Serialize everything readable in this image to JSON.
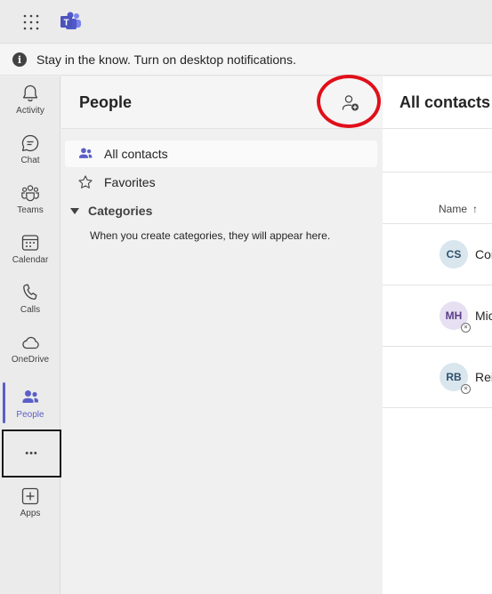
{
  "banner": {
    "text": "Stay in the know. Turn on desktop notifications."
  },
  "rail": {
    "items": [
      {
        "label": "Activity",
        "icon": "bell-icon"
      },
      {
        "label": "Chat",
        "icon": "chat-icon"
      },
      {
        "label": "Teams",
        "icon": "teams-icon"
      },
      {
        "label": "Calendar",
        "icon": "calendar-icon"
      },
      {
        "label": "Calls",
        "icon": "phone-icon"
      },
      {
        "label": "OneDrive",
        "icon": "cloud-icon"
      },
      {
        "label": "People",
        "icon": "people-icon"
      },
      {
        "label": "Apps",
        "icon": "add-app-icon"
      }
    ],
    "more_glyph": "•••",
    "active_color": "#5b5fc7"
  },
  "panel": {
    "title": "People",
    "nav": [
      {
        "label": "All contacts",
        "icon": "people-icon",
        "selected": true
      },
      {
        "label": "Favorites",
        "icon": "star-icon",
        "selected": false
      }
    ],
    "categories": {
      "label": "Categories",
      "hint": "When you create categories, they will appear here."
    },
    "highlight_color": "#e0101a"
  },
  "contacts": {
    "title": "All contacts",
    "column_name": "Name",
    "sort_arrow": "↑",
    "rows": [
      {
        "initials": "CS",
        "name": "Cor"
      },
      {
        "initials": "MH",
        "name": "Mic"
      },
      {
        "initials": "RB",
        "name": "Rei"
      }
    ]
  }
}
